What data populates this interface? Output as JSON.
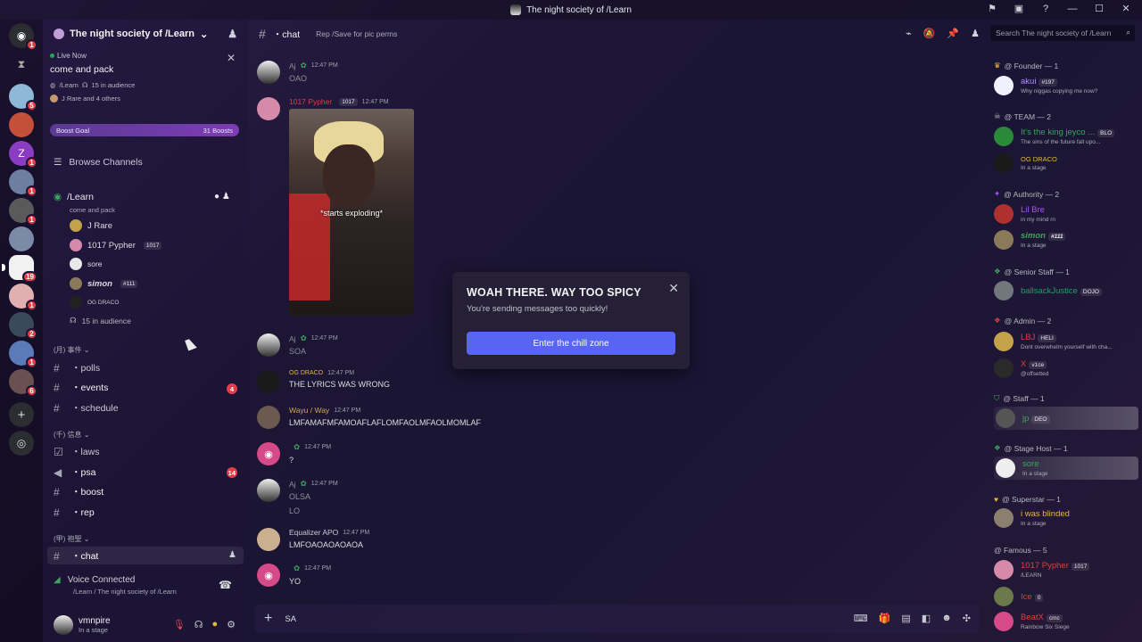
{
  "window": {
    "title": "The night society of /Learn"
  },
  "servers": {
    "badges": [
      "1",
      "5",
      "1",
      "1",
      "1",
      "1",
      "19",
      "1",
      "1",
      "2",
      "1",
      "6"
    ]
  },
  "sidebar": {
    "guild_name": "The night society of /Learn",
    "live": {
      "label": "Live Now",
      "title": "come and pack",
      "stage": "/Learn",
      "audience": "15 in audience",
      "others": "J Rare and 4 others"
    },
    "boost": {
      "label": "Boost Goal",
      "count": "31 Boosts"
    },
    "browse": "Browse Channels",
    "stage": {
      "name": "/Learn",
      "topic": "come and pack",
      "participants": [
        {
          "name": "J Rare",
          "tag": ""
        },
        {
          "name": "1017 Pypher",
          "tag": "1017"
        },
        {
          "name": "sore",
          "tag": ""
        },
        {
          "name": "simon",
          "tag": "#111"
        },
        {
          "name": "OG DRACO",
          "tag": ""
        }
      ],
      "audience": "15 in audience"
    },
    "categories": [
      {
        "label": "(月) 事件",
        "channels": [
          {
            "name": "・polls",
            "badge": ""
          },
          {
            "name": "・events",
            "badge": "4"
          },
          {
            "name": "・schedule",
            "badge": ""
          }
        ]
      },
      {
        "label": "(千) 信息",
        "channels": [
          {
            "name": "・laws",
            "badge": ""
          },
          {
            "name": "・psa",
            "badge": "14"
          },
          {
            "name": "・boost",
            "badge": ""
          },
          {
            "name": "・rep",
            "badge": ""
          }
        ]
      },
      {
        "label": "(甲) 袍聖",
        "channels": [
          {
            "name": "・chat",
            "badge": ""
          }
        ]
      }
    ],
    "voice": {
      "status": "Voice Connected",
      "channel": "/Learn / The night society of /Learn"
    },
    "user": {
      "name": "vmnpire",
      "status": "In a stage"
    }
  },
  "chat": {
    "channel": "・chat",
    "topic": "Rep /Save for pic perms",
    "search_placeholder": "Search The night society of /Learn",
    "messages": [
      {
        "author": "Aj",
        "time": "12:47 PM",
        "text": "OAO"
      },
      {
        "author": "1017 Pypher",
        "tag": "1017",
        "time": "12:47 PM",
        "caption": "*starts exploding*"
      },
      {
        "author": "Aj",
        "time": "12:47 PM",
        "text": "SOA"
      },
      {
        "author": "OG DRACO",
        "time": "12:47 PM",
        "text": "THE LYRICS WAS WRONG"
      },
      {
        "author": "Wayu / Way",
        "time": "12:47 PM",
        "text": "LMFAMAFMFAMOAFLAFLOMFAOLMFAOLMOMLAF"
      },
      {
        "author": "",
        "time": "12:47 PM",
        "text": "?"
      },
      {
        "author": "Aj",
        "time": "12:47 PM",
        "text": "OLSA",
        "text2": "LO"
      },
      {
        "author": "Equalizer APO",
        "time": "12:47 PM",
        "text": "LMFOAOAOAOAOA"
      },
      {
        "author": "",
        "time": "12:47 PM",
        "text": "YO"
      }
    ],
    "input_value": "SA"
  },
  "modal": {
    "title": "WOAH THERE. WAY TOO SPICY",
    "body": "You're sending messages too quickly!",
    "button": "Enter the chill zone"
  },
  "members": [
    {
      "group": "@ Founder — 1",
      "items": [
        {
          "name": "akui",
          "tag": "#197",
          "status": "Why niggas copying me now?",
          "color": "#b58cff"
        }
      ]
    },
    {
      "group": "@ TEAM — 2",
      "items": [
        {
          "name": "It's the king jeyco ...",
          "tag": "BLO",
          "status": "The sins of the future fall upo...",
          "color": "#3ba55c"
        },
        {
          "name": "OG DRACO",
          "tag": "",
          "status": "In a stage",
          "color": "#e6b83b"
        }
      ]
    },
    {
      "group": "@ Authority — 2",
      "items": [
        {
          "name": "Lil Bre",
          "tag": "",
          "status": "in my mind rn",
          "color": "#a855f7"
        },
        {
          "name": "simon",
          "tag": "#111",
          "status": "In a stage",
          "color": "#3ba55c"
        }
      ]
    },
    {
      "group": "@ Senior Staff — 1",
      "items": [
        {
          "name": "ballsackJustice",
          "tag": "DOJO",
          "status": "",
          "color": "#2a9a6a"
        }
      ]
    },
    {
      "group": "@ Admin — 2",
      "items": [
        {
          "name": "LBJ",
          "tag": "HELI",
          "status": "Dont overwhelm yourself with cha...",
          "color": "#d94040"
        },
        {
          "name": "X",
          "tag": "v1ce",
          "status": "@offsetted",
          "color": "#d94040"
        }
      ]
    },
    {
      "group": "@ Staff — 1",
      "items": [
        {
          "name": "jp",
          "tag": "DEO",
          "status": "",
          "color": "#3ba55c"
        }
      ]
    },
    {
      "group": "@ Stage Host — 1",
      "items": [
        {
          "name": "sore",
          "tag": "",
          "status": "In a stage",
          "color": "#3ba55c"
        }
      ]
    },
    {
      "group": "@ Superstar — 1",
      "items": [
        {
          "name": "i was blinded",
          "tag": "",
          "status": "In a stage",
          "color": "#e6b83b"
        }
      ]
    },
    {
      "group": "@ Famous — 5",
      "items": [
        {
          "name": "1017 Pypher",
          "tag": "1017",
          "status": "/LEARN",
          "color": "#d94040"
        },
        {
          "name": "Ice",
          "tag": "0",
          "status": "",
          "color": "#d94040"
        },
        {
          "name": "BeatX",
          "tag": "cmc",
          "status": "Rainbow Six Siege",
          "color": "#d94040"
        }
      ]
    }
  ]
}
